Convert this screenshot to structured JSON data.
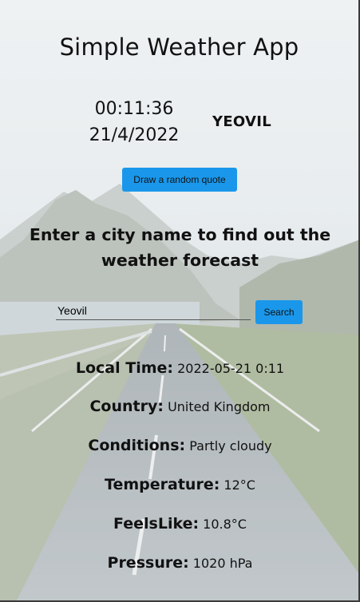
{
  "app": {
    "title": "Simple Weather App"
  },
  "clock": {
    "time": "00:11:36",
    "date": "21/4/2022"
  },
  "city_display": "YEOVIL",
  "quote_button_label": "Draw a random quote",
  "prompt_text": "Enter a city name to find out the weather forecast",
  "search": {
    "value": "Yeovil",
    "button_label": "Search"
  },
  "weather": [
    {
      "label": "Local Time:",
      "value": "2022-05-21 0:11"
    },
    {
      "label": "Country:",
      "value": "United Kingdom"
    },
    {
      "label": "Conditions:",
      "value": "Partly cloudy"
    },
    {
      "label": "Temperature:",
      "value": "12°C"
    },
    {
      "label": "FeelsLike:",
      "value": "10.8°C"
    },
    {
      "label": "Pressure:",
      "value": "1020 hPa"
    }
  ],
  "colors": {
    "button": "#1a97ea",
    "text": "#111111"
  }
}
